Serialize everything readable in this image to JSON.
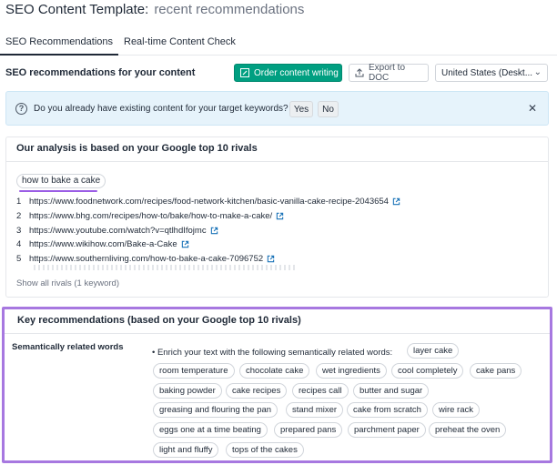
{
  "header": {
    "app_title": "SEO Content Template:",
    "subtitle": "recent recommendations"
  },
  "tabs": [
    {
      "label": "SEO Recommendations",
      "active": true
    },
    {
      "label": "Real-time Content Check",
      "active": false
    }
  ],
  "toolbar": {
    "title": "SEO recommendations for your content",
    "order_button": "Order content writing",
    "export_button": "Export to DOC",
    "region_select": "United States (Deskt..."
  },
  "banner": {
    "question": "Do you already have existing content for your target keywords?",
    "yes_label": "Yes",
    "no_label": "No",
    "close_icon": "close-icon"
  },
  "analysis": {
    "title": "Our analysis is based on your Google top 10 rivals",
    "keyword": "how to bake a cake",
    "rivals": [
      {
        "num": "1",
        "url": "https://www.foodnetwork.com/recipes/food-network-kitchen/basic-vanilla-cake-recipe-2043654"
      },
      {
        "num": "2",
        "url": "https://www.bhg.com/recipes/how-to/bake/how-to-make-a-cake/"
      },
      {
        "num": "3",
        "url": "https://www.youtube.com/watch?v=qtlhdIfojmc"
      },
      {
        "num": "4",
        "url": "https://www.wikihow.com/Bake-a-Cake"
      },
      {
        "num": "5",
        "url": "https://www.southernliving.com/how-to-bake-a-cake-7096752"
      }
    ],
    "show_all": "Show all rivals (1 keyword)",
    "accent_color": "#9b5de5"
  },
  "key_recommendations": {
    "title": "Key recommendations (based on your Google top 10 rivals)",
    "section_label": "Semantically related words",
    "lead_text": "• Enrich your text with the following semantically related words:",
    "border_color": "#a778e0",
    "words": [
      "layer cake",
      "room temperature",
      "chocolate cake",
      "wet ingredients",
      "cool completely",
      "cake pans",
      "baking powder",
      "cake recipes",
      "recipes call",
      "butter and sugar",
      "greasing and flouring the pan",
      "stand mixer",
      "cake from scratch",
      "wire rack",
      "eggs one at a time beating",
      "prepared pans",
      "parchment paper",
      "preheat the oven",
      "light and fluffy",
      "tops of the cakes"
    ]
  },
  "colors": {
    "brand_green": "#009f81",
    "banner_bg": "#e6f3fb",
    "link_icon": "#1a73b8"
  }
}
